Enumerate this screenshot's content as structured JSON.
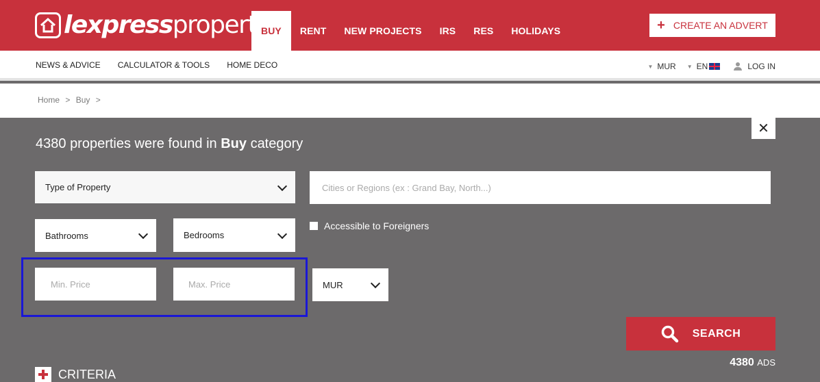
{
  "brand": {
    "logo_bold": "lexpress",
    "logo_light": "property",
    "accent": "#c8313c"
  },
  "main_nav": [
    {
      "label": "BUY"
    },
    {
      "label": "RENT"
    },
    {
      "label": "NEW PROJECTS"
    },
    {
      "label": "IRS"
    },
    {
      "label": "RES"
    },
    {
      "label": "HOLIDAYS"
    }
  ],
  "create_advert": {
    "plus": "+",
    "label": "CREATE AN ADVERT"
  },
  "sub_nav": [
    {
      "label": "NEWS & ADVICE"
    },
    {
      "label": "CALCULATOR & TOOLS"
    },
    {
      "label": "HOME DECO"
    }
  ],
  "sub_right": {
    "currency": "MUR",
    "language": "EN",
    "login": "LOG IN"
  },
  "breadcrumb": {
    "home": "Home",
    "sep1": ">",
    "buy": "Buy",
    "sep2": ">"
  },
  "results": {
    "count": "4380",
    "text_mid": "properties were found in",
    "category": "Buy",
    "text_end": "category"
  },
  "close_label": "✕",
  "form": {
    "type_of_property": "Type of Property",
    "cities_placeholder": "Cities or Regions (ex : Grand Bay, North...)",
    "bathrooms": "Bathrooms",
    "bedrooms": "Bedrooms",
    "accessible_label": "Accessible to Foreigners",
    "min_price_placeholder": "Min. Price",
    "max_price_placeholder": "Max. Price",
    "currency": "MUR"
  },
  "search_label": "SEARCH",
  "ads": {
    "count": "4380",
    "label": "ADS"
  },
  "criteria_label": "CRITERIA"
}
